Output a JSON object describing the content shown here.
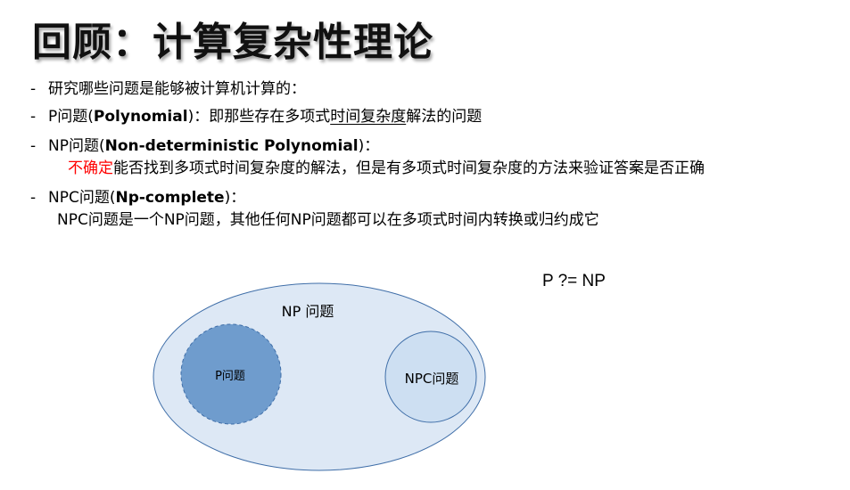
{
  "title": "回顾：计算复杂性理论",
  "bullets": [
    {
      "dash": "-",
      "text": "研究哪些问题是能够被计算机计算的："
    },
    {
      "dash": "-",
      "prefix": "P问题(",
      "term": "Polynomial",
      "middle": ")：即那些存在多项式",
      "underlined": "时间复杂度",
      "suffix": "解法的问题"
    },
    {
      "dash": "-",
      "prefix": "NP问题(",
      "term": "Non-deterministic Polynomial",
      "suffix": ")：",
      "detail_red": "不确定",
      "detail_rest": "能否找到多项式时间复杂度的解法，但是有多项式时间复杂度的方法来验证答案是否正确"
    },
    {
      "dash": "-",
      "prefix": "NPC问题(",
      "term": "Np-complete",
      "suffix": ")：",
      "detail": "NPC问题是一个NP问题，其他任何NP问题都可以在多项式时间内转换或归约成它"
    }
  ],
  "formula": "P ?= NP",
  "diagram": {
    "outer_label": "NP 问题",
    "left_label": "P问题",
    "right_label": "NPC问题",
    "colors": {
      "outer_fill": "#dde8f5",
      "outer_stroke": "#3f6ea8",
      "p_fill": "#6f9ccd",
      "p_stroke": "#3f6ea8",
      "npc_fill": "#cddff2",
      "npc_stroke": "#3f6ea8",
      "red_text": "#ff0000"
    }
  }
}
